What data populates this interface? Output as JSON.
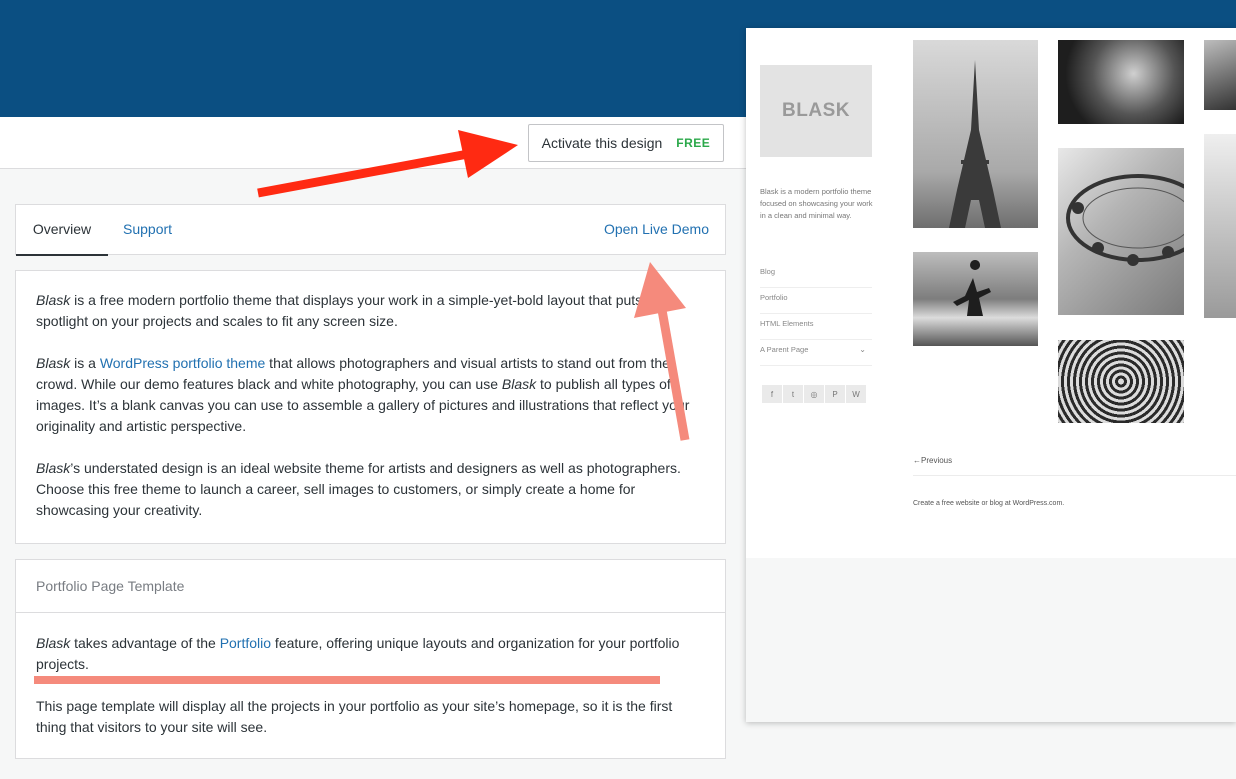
{
  "action_bar": {
    "activate_label": "Activate this design",
    "activate_badge": "FREE"
  },
  "tabs": {
    "overview": "Overview",
    "support": "Support",
    "open_live_demo": "Open Live Demo"
  },
  "description": {
    "p1": {
      "theme_name": "Blask",
      "text": " is a free modern portfolio theme that displays your work in a simple-yet-bold layout that puts the spotlight on your projects and scales to fit any screen size."
    },
    "p2": {
      "theme_name": "Blask",
      "text_a": " is a ",
      "link": "WordPress portfolio theme",
      "text_b": " that allows photographers and visual artists to stand out from the crowd. While our demo features black and white photography, you can use ",
      "theme_name_2": "Blask",
      "text_c": " to publish all types of images. It’s a blank canvas you can use to assemble a gallery of pictures and illustrations that reflect your originality and artistic perspective."
    },
    "p3": {
      "theme_name": "Blask",
      "text": "’s understated design is an ideal website theme for artists and designers as well as photographers. Choose this free theme to launch a career, sell images to customers, or simply create a home for showcasing your creativity."
    }
  },
  "portfolio_template": {
    "heading": "Portfolio Page Template",
    "p1": {
      "theme_name": "Blask",
      "text_a": " takes advantage of the ",
      "link": "Portfolio",
      "text_b": " feature, offering unique layouts and organization for your portfolio projects."
    },
    "p2": "This page template will display all the projects in your portfolio as your site’s homepage, so it is the first thing that visitors to your site will see."
  },
  "preview": {
    "logo": "BLASK",
    "tagline": "Blask is a modern portfolio theme focused on showcasing your work in a clean and minimal way.",
    "nav": [
      "Blog",
      "Portfolio",
      "HTML Elements",
      "A Parent Page"
    ],
    "social": [
      "f",
      "t",
      "◎",
      "P",
      "W"
    ],
    "previous_link": "←Previous",
    "footer": "Create a free website or blog at WordPress.com."
  },
  "colors": {
    "header_blue": "#0b4f82",
    "link_blue": "#2271b1",
    "free_green": "#2ba84a",
    "arrow_red": "#ff2a12",
    "arrow_salmon": "#f58a7c"
  }
}
